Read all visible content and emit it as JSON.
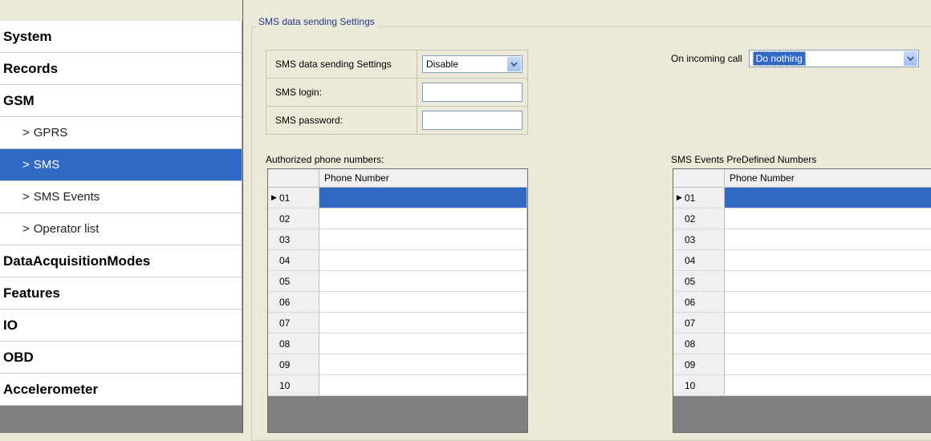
{
  "sidebar": {
    "items": [
      {
        "label": "System",
        "kind": "cat"
      },
      {
        "label": "Records",
        "kind": "cat"
      },
      {
        "label": "GSM",
        "kind": "cat"
      },
      {
        "label": "GPRS",
        "kind": "sub"
      },
      {
        "label": "SMS",
        "kind": "sub",
        "selected": true
      },
      {
        "label": "SMS Events",
        "kind": "sub"
      },
      {
        "label": "Operator list",
        "kind": "sub"
      },
      {
        "label": "DataAcquisitionModes",
        "kind": "cat"
      },
      {
        "label": "Features",
        "kind": "cat"
      },
      {
        "label": "IO",
        "kind": "cat"
      },
      {
        "label": "OBD",
        "kind": "cat"
      },
      {
        "label": "Accelerometer",
        "kind": "cat"
      }
    ],
    "chevron": ">"
  },
  "group": {
    "title": "SMS data sending Settings"
  },
  "settings": {
    "sms_data_sending_label": "SMS data sending Settings",
    "sms_data_sending_value": "Disable",
    "sms_login_label": "SMS login:",
    "sms_login_value": "",
    "sms_password_label": "SMS password:",
    "sms_password_value": "",
    "on_incoming_call_label": "On incoming call",
    "on_incoming_call_value": "Do nothing"
  },
  "authorized_table": {
    "caption": "Authorized phone numbers:",
    "column": "Phone Number",
    "rows": [
      "01",
      "02",
      "03",
      "04",
      "05",
      "06",
      "07",
      "08",
      "09",
      "10"
    ]
  },
  "events_table": {
    "caption": "SMS Events PreDefined Numbers",
    "column": "Phone Number",
    "rows": [
      "01",
      "02",
      "03",
      "04",
      "05",
      "06",
      "07",
      "08",
      "09",
      "10"
    ]
  },
  "icons": {
    "dropdown": "chevron-down-icon",
    "row_marker": "row-pointer-icon"
  },
  "colors": {
    "selection": "#316ac5",
    "window_bg": "#ece9d8"
  }
}
